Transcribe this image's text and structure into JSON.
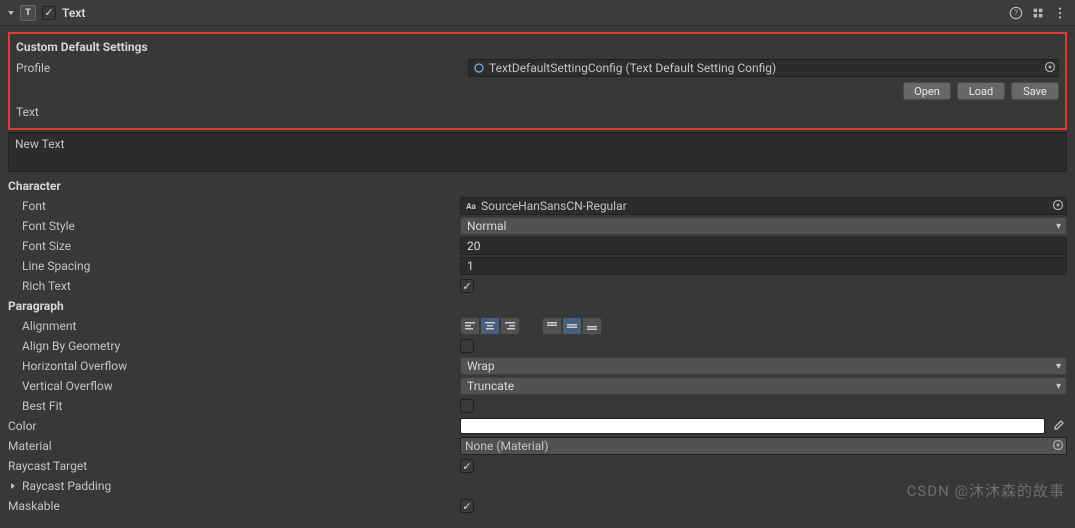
{
  "header": {
    "title": "Text",
    "enabled": true
  },
  "custom": {
    "section_title": "Custom Default Settings",
    "profile_label": "Profile",
    "profile_value": "TextDefaultSettingConfig (Text Default Setting Config)",
    "open_btn": "Open",
    "load_btn": "Load",
    "save_btn": "Save",
    "text_label": "Text"
  },
  "text_value": "New Text",
  "character": {
    "section": "Character",
    "font_label": "Font",
    "font_value": "SourceHanSansCN-Regular",
    "font_style_label": "Font Style",
    "font_style_value": "Normal",
    "font_size_label": "Font Size",
    "font_size_value": "20",
    "line_spacing_label": "Line Spacing",
    "line_spacing_value": "1",
    "rich_text_label": "Rich Text",
    "rich_text_value": true
  },
  "paragraph": {
    "section": "Paragraph",
    "alignment_label": "Alignment",
    "h_align": "center",
    "v_align": "middle",
    "align_geom_label": "Align By Geometry",
    "align_geom_value": false,
    "h_overflow_label": "Horizontal Overflow",
    "h_overflow_value": "Wrap",
    "v_overflow_label": "Vertical Overflow",
    "v_overflow_value": "Truncate",
    "best_fit_label": "Best Fit",
    "best_fit_value": false
  },
  "color_label": "Color",
  "color_value": "#FFFFFF",
  "material_label": "Material",
  "material_value": "None (Material)",
  "raycast_label": "Raycast Target",
  "raycast_value": true,
  "raycast_padding_label": "Raycast Padding",
  "maskable_label": "Maskable",
  "maskable_value": true,
  "watermark": "CSDN @沐沐森的故事"
}
